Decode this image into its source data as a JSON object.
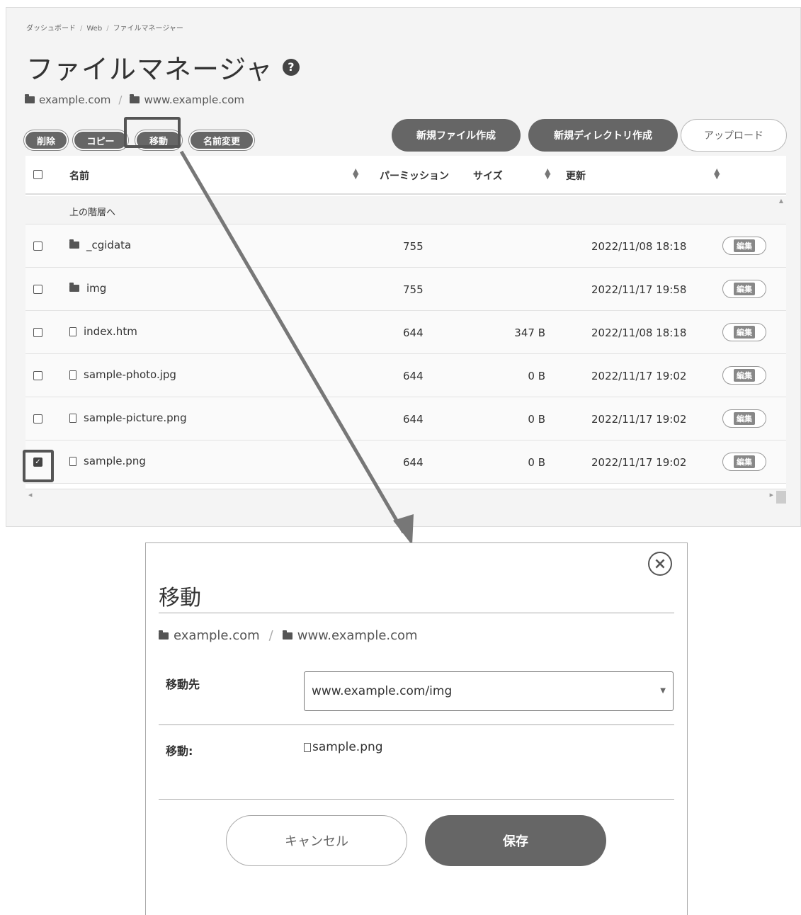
{
  "breadcrumb": [
    "ダッシュボード",
    "Web",
    "ファイルマネージャー"
  ],
  "page_title": "ファイルマネージャ",
  "path": [
    "example.com",
    "www.example.com"
  ],
  "actions": {
    "delete": "削除",
    "copy": "コピー",
    "move": "移動",
    "rename": "名前変更",
    "new_file": "新規ファイル作成",
    "new_dir": "新規ディレクトリ作成",
    "upload": "アップロード"
  },
  "table": {
    "headers": {
      "name": "名前",
      "permission": "パーミッション",
      "size": "サイズ",
      "updated": "更新"
    },
    "parent": "上の階層へ",
    "edit_label": "編集",
    "rows": [
      {
        "type": "folder",
        "name": "_cgidata",
        "permission": "755",
        "size": "",
        "updated": "2022/11/08 18:18",
        "checked": false
      },
      {
        "type": "folder",
        "name": "img",
        "permission": "755",
        "size": "",
        "updated": "2022/11/17 19:58",
        "checked": false
      },
      {
        "type": "file",
        "name": "index.htm",
        "permission": "644",
        "size": "347 B",
        "updated": "2022/11/08 18:18",
        "checked": false
      },
      {
        "type": "file",
        "name": "sample-photo.jpg",
        "permission": "644",
        "size": "0 B",
        "updated": "2022/11/17 19:02",
        "checked": false
      },
      {
        "type": "file",
        "name": "sample-picture.png",
        "permission": "644",
        "size": "0 B",
        "updated": "2022/11/17 19:02",
        "checked": false
      },
      {
        "type": "file",
        "name": "sample.png",
        "permission": "644",
        "size": "0 B",
        "updated": "2022/11/17 19:02",
        "checked": true
      }
    ]
  },
  "modal": {
    "title": "移動",
    "path": [
      "example.com",
      "www.example.com"
    ],
    "dest_label": "移動先",
    "dest_value": "www.example.com/img",
    "move_label": "移動:",
    "move_file": "sample.png",
    "cancel": "キャンセル",
    "save": "保存"
  }
}
